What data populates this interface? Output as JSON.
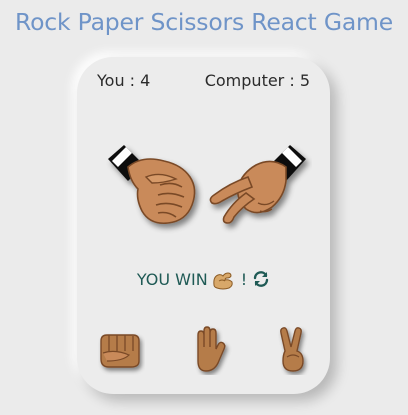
{
  "header": {
    "title": "Rock Paper Scissors React Game"
  },
  "scoreboard": {
    "player_label": "You : 4",
    "computer_label": "Computer : 5"
  },
  "board": {
    "player_hand": "rock",
    "computer_hand": "scissors"
  },
  "result": {
    "text": "YOU WIN",
    "icon": "flexed-biceps-icon",
    "suffix": "!",
    "restart_icon": "restart-icon"
  },
  "choices": [
    {
      "name": "rock",
      "icon": "rock-fist-icon"
    },
    {
      "name": "paper",
      "icon": "paper-hand-icon"
    },
    {
      "name": "scissors",
      "icon": "scissors-hand-icon"
    }
  ],
  "colors": {
    "title": "#6f94c8",
    "background": "#ebebeb",
    "result_text": "#1f5a55",
    "skin": "#c98a5a",
    "skin_dark": "#8a5530",
    "cuff": "#1a1a1a"
  }
}
